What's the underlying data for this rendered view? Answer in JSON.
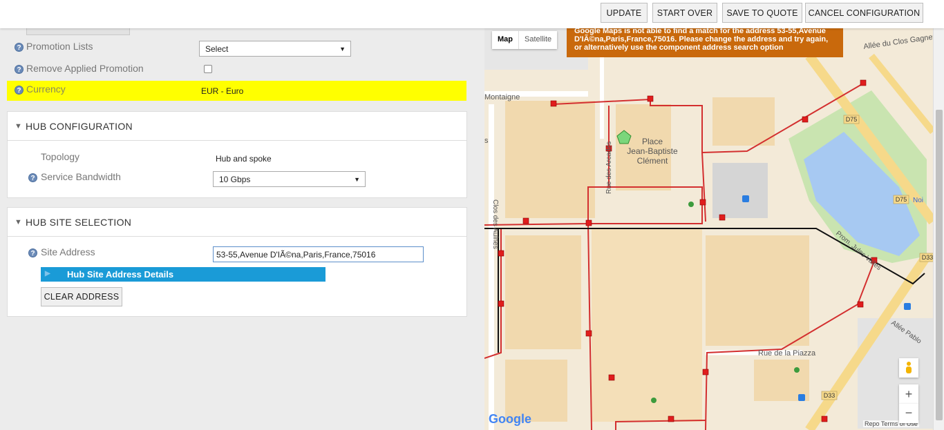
{
  "toolbar": {
    "update": "UPDATE",
    "start_over": "START OVER",
    "save_to_quote": "SAVE TO QUOTE",
    "cancel_configuration": "CANCEL CONFIGURATION"
  },
  "form": {
    "promotion_lists_label": "Promotion Lists",
    "promotion_lists_value": "Select",
    "remove_promotion_label": "Remove Applied Promotion",
    "remove_promotion_checked": false,
    "currency_label": "Currency",
    "currency_value": "EUR - Euro",
    "highlight_color": "#ffff00"
  },
  "hub_configuration": {
    "title": "HUB CONFIGURATION",
    "topology_label": "Topology",
    "topology_value": "Hub and spoke",
    "bandwidth_label": "Service Bandwidth",
    "bandwidth_value": "10 Gbps"
  },
  "hub_site_selection": {
    "title": "HUB SITE SELECTION",
    "site_address_label": "Site Address",
    "site_address_value": "53-55,Avenue D'IÃ©na,Paris,France,75016",
    "details_bar": "Hub Site Address Details",
    "clear_address": "CLEAR ADDRESS"
  },
  "map": {
    "type_map": "Map",
    "type_satellite": "Satellite",
    "alert_text": "Google Maps is not able to find a match for the address 53-55,Avenue D'IÃ©na,Paris,France,75016. Please change the address and try again, or alternatively use the component address search option",
    "alert_color": "#c9690c",
    "zoom_in": "+",
    "zoom_out": "−",
    "logo": "Google",
    "footer_report": "Repo",
    "footer_terms": "Terms of Use",
    "labels": {
      "allee_clos": "Allée du Clos Gagneur",
      "montaigne": "Montaigne",
      "place_1": "Place",
      "place_2": "Jean-Baptiste",
      "place_3": "Clément",
      "rue_arcades": "Rue des Arcades",
      "clos_aulnes": "Clos des Aulnes",
      "prom_jules": "Prom. Jules Vallès",
      "rue_piazza": "Rue de la Piazza",
      "allee_pablo": "Allée Pablo",
      "d75_a": "D75",
      "d75_b": "D75",
      "d33_a": "D33",
      "d33_b": "D33",
      "noi": "Noi",
      "s": "s"
    }
  }
}
